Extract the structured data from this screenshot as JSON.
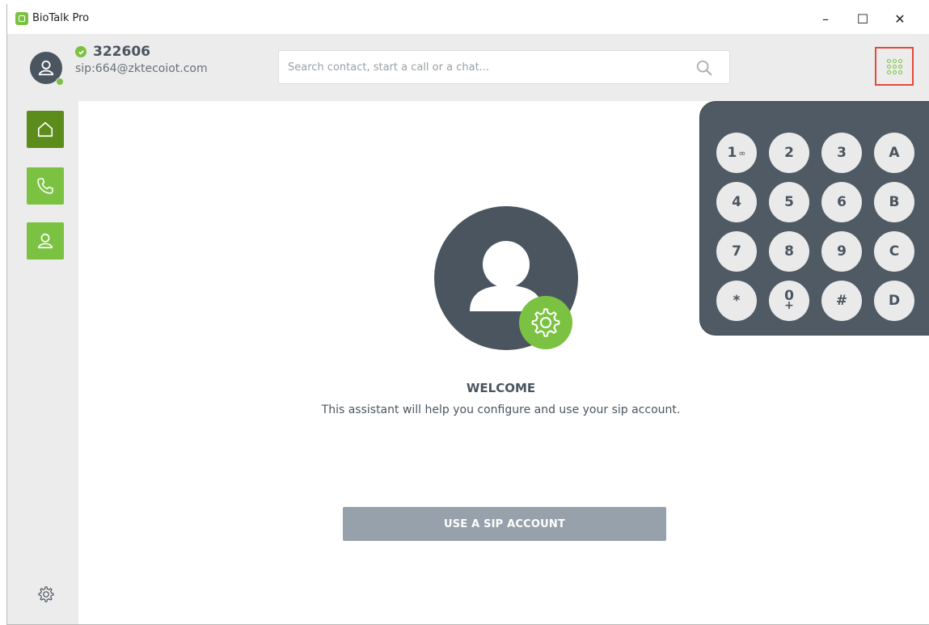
{
  "window": {
    "title": "BioTalk Pro",
    "minimize": "–",
    "maximize": "☐",
    "close": "✕"
  },
  "user": {
    "name": "322606",
    "sip": "sip:664@zktecoiot.com",
    "status": "online"
  },
  "search": {
    "placeholder": "Search contact, start a call or a chat...",
    "value": ""
  },
  "sidebar": {
    "items": [
      "home",
      "calls",
      "contacts"
    ],
    "settings": "settings"
  },
  "welcome": {
    "title": "WELCOME",
    "text": "This assistant will help you configure and use your sip account.",
    "button": "USE A SIP ACCOUNT"
  },
  "dialpad": {
    "keys": [
      "1",
      "2",
      "3",
      "A",
      "4",
      "5",
      "6",
      "B",
      "7",
      "8",
      "9",
      "C",
      "*",
      "0",
      "#",
      "D"
    ],
    "voicemail_glyph": "∞",
    "zero_sub": "+"
  },
  "colors": {
    "accent": "#7cc242",
    "accent_dark": "#5b8c1c",
    "slate": "#4b5560",
    "highlight": "#e34a3c"
  }
}
